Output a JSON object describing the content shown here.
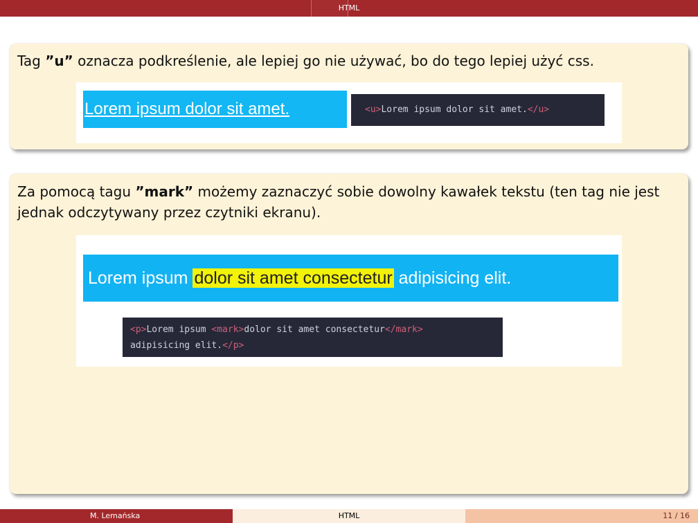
{
  "header": {
    "title": "HTML"
  },
  "block1": {
    "text_before": "Tag ",
    "tag_name": "”u”",
    "text_after": " oznacza podkreślenie, ale lepiej go nie używać, bo do tego lepiej użyć css.",
    "demo_text": "Lorem ipsum dolor sit amet.",
    "code": {
      "open": "<u>",
      "content": "Lorem ipsum dolor sit amet.",
      "close": "</u>"
    }
  },
  "block2": {
    "text_before": "Za pomocą tagu ",
    "tag_name": "”mark”",
    "text_after": " możemy zaznaczyć sobie dowolny kawałek tekstu (ten tag nie jest jednak odczytywany przez czytniki ekranu).",
    "demo": {
      "before": "Lorem ipsum ",
      "highlight": "dolor sit amet consectetur",
      "after": " adipisicing elit."
    },
    "code": {
      "p_open": "<p>",
      "text1": "Lorem ipsum ",
      "mark_open": "<mark>",
      "text2": "dolor sit amet consectetur",
      "mark_close": "</mark>",
      "text3": "adipisicing elit.",
      "p_close": "</p>"
    }
  },
  "footer": {
    "author": "M. Lemańska",
    "title": "HTML",
    "page": "11 / 16"
  },
  "colors": {
    "bar": "#a3282b",
    "block_bg": "#fdf3d8",
    "demo_blue": "#12b7f3",
    "highlight": "#f2f20a",
    "code_bg": "#262838"
  }
}
